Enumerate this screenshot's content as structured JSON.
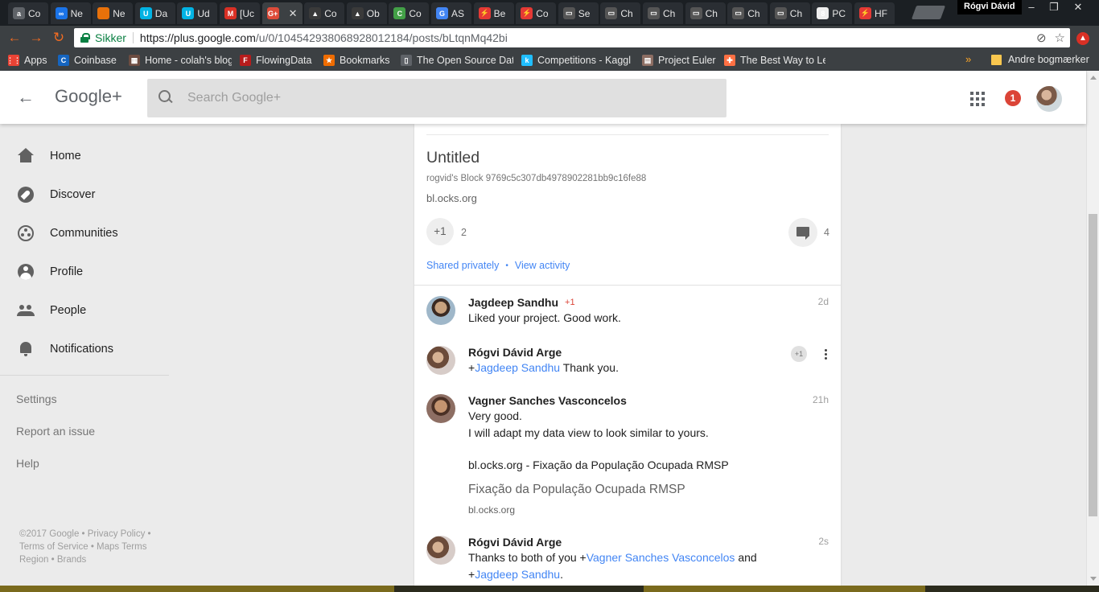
{
  "browser": {
    "tabs": [
      {
        "label": "Co",
        "color": "#5f6368",
        "glyph": "a"
      },
      {
        "label": "Ne",
        "color": "#1a73e8",
        "glyph": "∞"
      },
      {
        "label": "Ne",
        "color": "#e8710a",
        "glyph": ""
      },
      {
        "label": "Da",
        "color": "#02b3e4",
        "glyph": "U"
      },
      {
        "label": "Ud",
        "color": "#02b3e4",
        "glyph": "U"
      },
      {
        "label": "[Uc",
        "color": "#d93025",
        "glyph": "M"
      },
      {
        "label": "",
        "color": "#dd4b39",
        "glyph": "G+"
      },
      {
        "label": "Co",
        "color": "#3a3a3a",
        "glyph": "▲"
      },
      {
        "label": "Ob",
        "color": "#3a3a3a",
        "glyph": "▲"
      },
      {
        "label": "Co",
        "color": "#43a047",
        "glyph": "C"
      },
      {
        "label": "AS",
        "color": "#4285f4",
        "glyph": "G"
      },
      {
        "label": "Be",
        "color": "#e53935",
        "glyph": "⚡"
      },
      {
        "label": "Co",
        "color": "#e53935",
        "glyph": "⚡"
      },
      {
        "label": "Se",
        "color": "#555",
        "glyph": "▭"
      },
      {
        "label": "Ch",
        "color": "#555",
        "glyph": "▭"
      },
      {
        "label": "Ch",
        "color": "#555",
        "glyph": "▭"
      },
      {
        "label": "Ch",
        "color": "#555",
        "glyph": "▭"
      },
      {
        "label": "Ch",
        "color": "#555",
        "glyph": "▭"
      },
      {
        "label": "Ch",
        "color": "#555",
        "glyph": "▭"
      },
      {
        "label": "PC",
        "color": "#eee",
        "glyph": "8"
      },
      {
        "label": "HF",
        "color": "#e53935",
        "glyph": "⚡"
      }
    ],
    "user": "Rógvi Dávid",
    "window_buttons": [
      "–",
      "❐",
      "✕"
    ],
    "secure_label": "Sikker",
    "url_host": "https://plus.google.com",
    "url_path": "/u/0/104542938068928012184/posts/bLtqnMq42bi",
    "bookmarks": [
      {
        "label": "Apps",
        "color": "#ea4335",
        "glyph": "⋮⋮"
      },
      {
        "label": "Coinbase",
        "color": "#1565c0",
        "glyph": "C"
      },
      {
        "label": "Home - colah's blog",
        "color": "#6d4c41",
        "glyph": "▦"
      },
      {
        "label": "FlowingData",
        "color": "#b71c1c",
        "glyph": "F"
      },
      {
        "label": "Bookmarks",
        "color": "#ef6c00",
        "glyph": "★"
      },
      {
        "label": "The Open Source Dat",
        "color": "#5f6368",
        "glyph": "▯"
      },
      {
        "label": "Competitions - Kaggl",
        "color": "#20beff",
        "glyph": "k"
      },
      {
        "label": "Project Euler",
        "color": "#8d6e63",
        "glyph": "▤"
      },
      {
        "label": "The Best Way to Lear",
        "color": "#ff7043",
        "glyph": "✚"
      }
    ],
    "bookmarks_more": "»",
    "other_bookmarks": "Andre bogmærker",
    "menu_badge": "▲"
  },
  "app": {
    "logo": "Google+",
    "search_placeholder": "Search Google+",
    "notification_count": "1"
  },
  "nav": {
    "items": [
      {
        "label": "Home"
      },
      {
        "label": "Discover"
      },
      {
        "label": "Communities"
      },
      {
        "label": "Profile"
      },
      {
        "label": "People"
      },
      {
        "label": "Notifications"
      }
    ],
    "links": [
      "Settings",
      "Report an issue",
      "Help"
    ],
    "footer": "©2017 Google • Privacy Policy • Terms of Service • Maps Terms Region • Brands"
  },
  "post": {
    "link_title": "Untitled",
    "link_description": "rogvid's Block 9769c5c307db4978902281bb9c16fe88",
    "link_domain": "bl.ocks.org",
    "plusone_label": "+1",
    "plusone_count": "2",
    "comment_count": "4",
    "shared_label": "Shared privately",
    "separator": "•",
    "view_activity_label": "View activity"
  },
  "comments": [
    {
      "author": "Jagdeep Sandhu",
      "plus": "+1",
      "time": "2d",
      "text": "Liked your project. Good work."
    },
    {
      "author": "Rógvi Dávid Arge",
      "plus_button": "+1",
      "mention_prefix": "+",
      "mention": "Jagdeep Sandhu",
      "text_after": " Thank you."
    },
    {
      "author": "Vagner Sanches Vasconcelos",
      "time": "21h",
      "line1": "Very good.",
      "line2": "I will adapt my data view to look similar to yours.",
      "link": "bl.ocks.org - Fixação da População Ocupada RMSP",
      "embed_title": "Fixação da População Ocupada RMSP",
      "embed_domain": "bl.ocks.org"
    },
    {
      "author": "Rógvi Dávid Arge",
      "time": "2s",
      "text_before": "Thanks to both of you +",
      "mention1": "Vagner Sanches Vasconcelos",
      "text_mid": " and",
      "line2_prefix": "+",
      "mention2": "Jagdeep Sandhu",
      "text_end": "."
    }
  ]
}
